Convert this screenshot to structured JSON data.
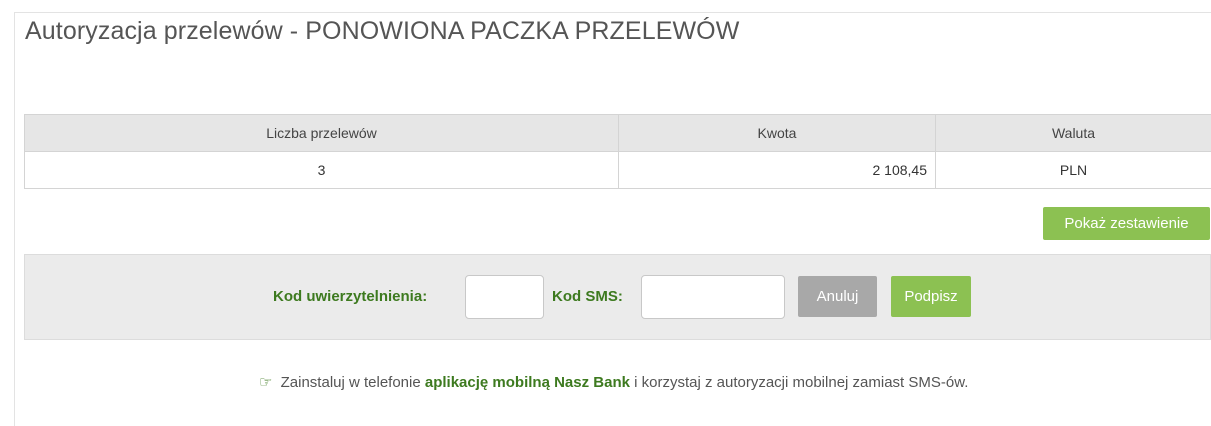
{
  "page": {
    "title": "Autoryzacja przelewów - PONOWIONA PACZKA PRZELEWÓW"
  },
  "summary_table": {
    "headers": [
      "Liczba przelewów",
      "Kwota",
      "Waluta"
    ],
    "rows": [
      {
        "count": "3",
        "amount": "2 108,45",
        "currency": "PLN"
      }
    ]
  },
  "buttons": {
    "show_summary": "Pokaż zestawienie",
    "cancel": "Anuluj",
    "sign": "Podpisz"
  },
  "auth_form": {
    "auth_code_label": "Kod uwierzytelnienia:",
    "auth_code_value": "",
    "sms_code_label": "Kod SMS:",
    "sms_code_value": ""
  },
  "promo": {
    "icon": "hand-pointing-right-icon",
    "glyph": "☞",
    "text_before": "Zainstaluj w telefonie",
    "link_text": "aplikację mobilną Nasz Bank",
    "text_after": "i korzystaj z autoryzacji mobilnej zamiast SMS-ów."
  },
  "colors": {
    "accent_green": "#8cc152",
    "label_green": "#3d7a1f",
    "cancel_gray": "#a8a8a8",
    "header_gray": "#e6e6e6",
    "panel_gray": "#ebebeb"
  }
}
